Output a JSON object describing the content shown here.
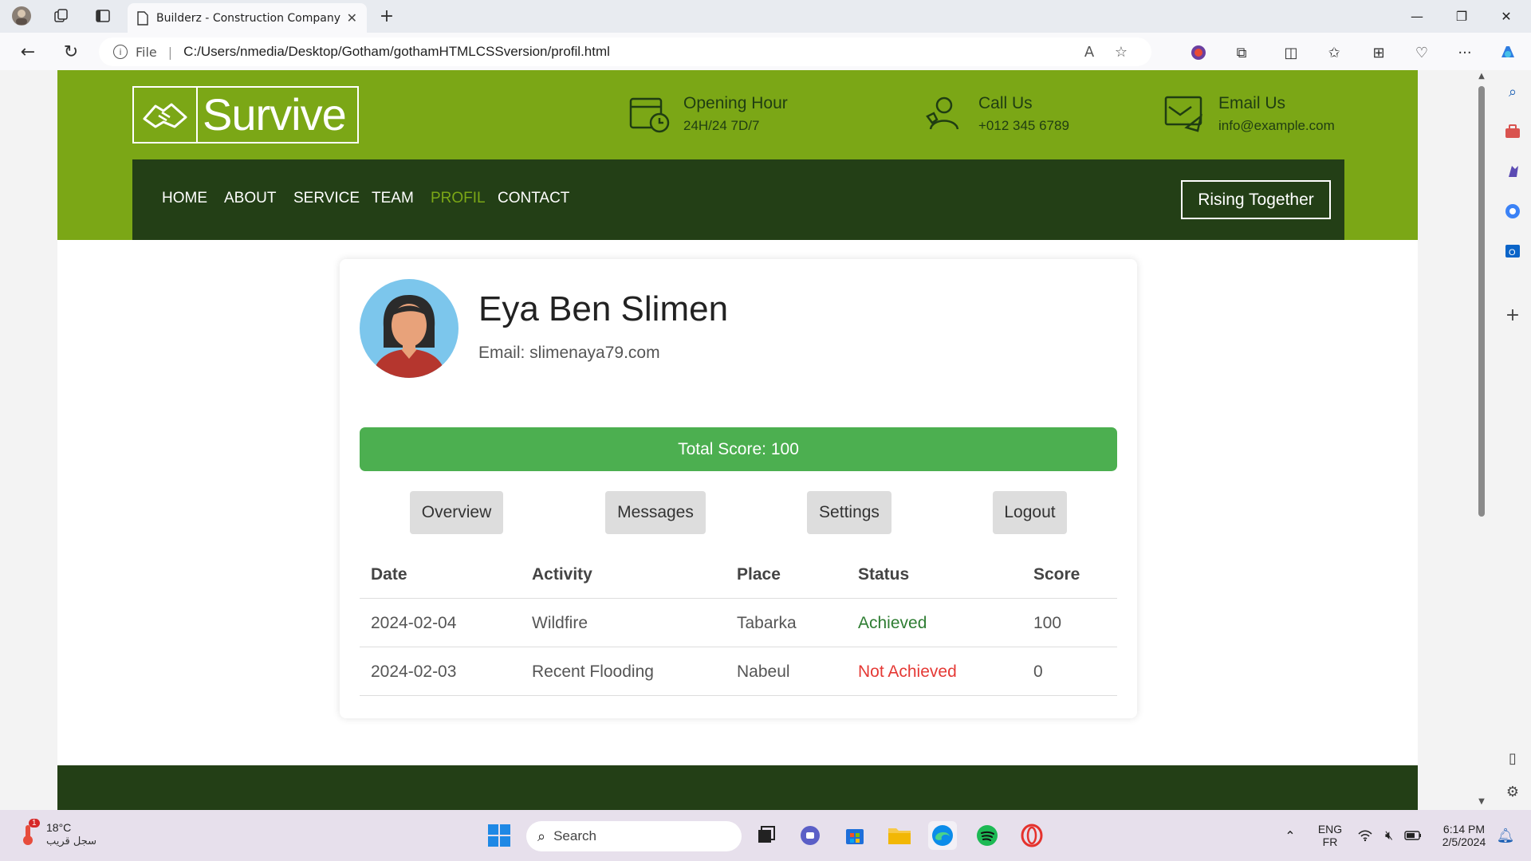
{
  "browser": {
    "tab_title": "Builderz - Construction Company",
    "url_label": "File",
    "url": "C:/Users/nmedia/Desktop/Gotham/gothamHTMLCSSversion/profil.html"
  },
  "site": {
    "logo_text": "Survive",
    "contacts": [
      {
        "title": "Opening Hour",
        "value": "24H/24 7D/7",
        "icon": "calendar-clock-icon"
      },
      {
        "title": "Call Us",
        "value": "+012 345 6789",
        "icon": "phone-support-icon"
      },
      {
        "title": "Email Us",
        "value": "info@example.com",
        "icon": "email-icon"
      }
    ],
    "nav": {
      "items": [
        "HOME",
        "ABOUT",
        "SERVICE",
        "TEAM",
        "PROFIL",
        "CONTACT"
      ],
      "active": "PROFIL",
      "cta": "Rising Together"
    },
    "colors": {
      "primary": "#7ba716",
      "dark": "#233f16",
      "score": "#4caf50"
    }
  },
  "profile": {
    "name": "Eya Ben Slimen",
    "email": "Email: slimenaya79.com",
    "total_score": "Total Score: 100",
    "buttons": [
      "Overview",
      "Messages",
      "Settings",
      "Logout"
    ],
    "table": {
      "headers": [
        "Date",
        "Activity",
        "Place",
        "Status",
        "Score"
      ],
      "rows": [
        {
          "date": "2024-02-04",
          "activity": "Wildfire",
          "place": "Tabarka",
          "status": "Achieved",
          "score": "100"
        },
        {
          "date": "2024-02-03",
          "activity": "Recent Flooding",
          "place": "Nabeul",
          "status": "Not Achieved",
          "score": "0"
        }
      ]
    }
  },
  "taskbar": {
    "temperature": "18°C",
    "weather_desc": "سجل قريب",
    "weather_badge": "1",
    "search": "Search",
    "lang_top": "ENG",
    "lang_bottom": "FR",
    "time": "6:14 PM",
    "date": "2/5/2024"
  }
}
